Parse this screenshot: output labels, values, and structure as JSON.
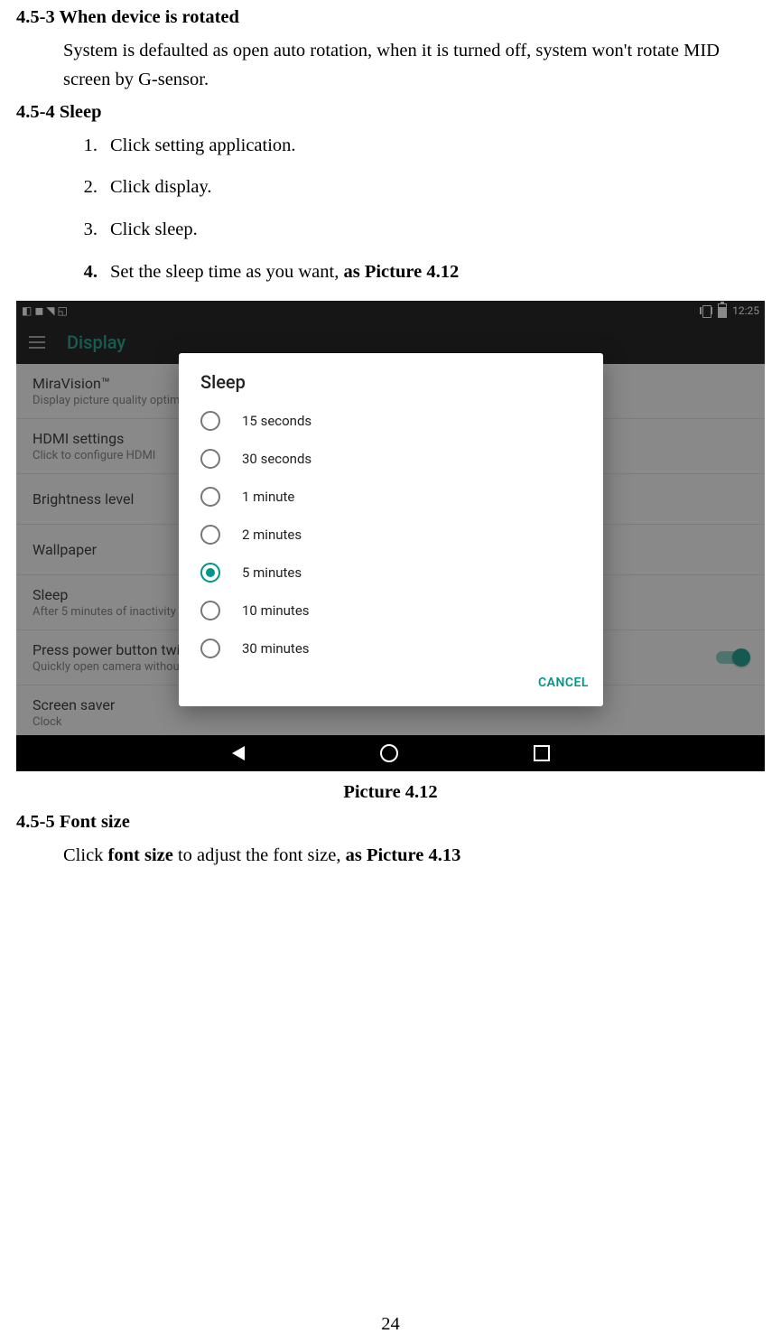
{
  "doc": {
    "sec453": {
      "title": "4.5-3 When device is rotated",
      "body": "System is defaulted as open auto rotation, when it is turned off, system won't rotate MID screen by G-sensor."
    },
    "sec454": {
      "title": "4.5-4 Sleep",
      "steps": [
        "Click setting application.",
        "Click display.",
        "Click sleep."
      ],
      "step4_prefix": "Set the sleep time as you want, ",
      "step4_bold": "as Picture 4.12"
    },
    "caption_412": "Picture 4.12",
    "sec455": {
      "title": "4.5-5 Font size",
      "line_prefix": "Click ",
      "line_bold1": "font size",
      "line_mid": " to adjust the font size, ",
      "line_bold2": "as Picture 4.13"
    },
    "page_number": "24"
  },
  "screenshot": {
    "statusbar": {
      "icons_left": "◧ ◼ ◥ ◱",
      "time": "12:25"
    },
    "appbar_title": "Display",
    "rows": [
      {
        "title": "MiraVision™",
        "sub": "Display picture quality optimization"
      },
      {
        "title": "HDMI settings",
        "sub": "Click to configure HDMI"
      },
      {
        "title": "Brightness level",
        "sub": ""
      },
      {
        "title": "Wallpaper",
        "sub": ""
      },
      {
        "title": "Sleep",
        "sub": "After 5 minutes of inactivity"
      },
      {
        "title": "Press power button twice for camera",
        "sub": "Quickly open camera without unlocking your screen",
        "switch": true
      },
      {
        "title": "Screen saver",
        "sub": "Clock"
      }
    ],
    "dialog": {
      "title": "Sleep",
      "options": [
        {
          "label": "15 seconds",
          "selected": false
        },
        {
          "label": "30 seconds",
          "selected": false
        },
        {
          "label": "1 minute",
          "selected": false
        },
        {
          "label": "2 minutes",
          "selected": false
        },
        {
          "label": "5 minutes",
          "selected": true
        },
        {
          "label": "10 minutes",
          "selected": false
        },
        {
          "label": "30 minutes",
          "selected": false
        }
      ],
      "cancel": "CANCEL"
    }
  }
}
